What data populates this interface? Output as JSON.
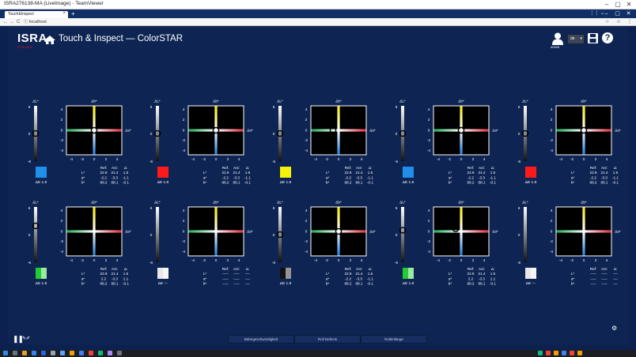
{
  "window": {
    "title": "ISRA276138-MA (LiveImage) - TeamViewer",
    "minimize": "–",
    "maximize": "▢",
    "close": "✕"
  },
  "browser": {
    "tab_label": "Touch&Inspect",
    "tab_close": "×",
    "new_tab": "+",
    "tab_controls": "⋮⋮ ⌄",
    "win_min": "–",
    "win_max": "▢",
    "win_close": "✕",
    "back": "←",
    "forward": "→",
    "reload": "C",
    "url": "ⓘ localhost",
    "bookmark": "☆",
    "account": "☺",
    "menu": "⋮"
  },
  "app": {
    "logo": "ISRA",
    "logo_sub": "VISION",
    "title": "Touch & Inspect — ColorSTAR",
    "user_label": "ADMIN",
    "language": "de",
    "language_caret": "▾",
    "help": "?",
    "accent": "#0e2554"
  },
  "panels": [
    {
      "swatch": "#1f8fe8",
      "swatch_type": "solid",
      "delta": "ΔE 1.8",
      "marker": {
        "a": 0.0,
        "b": 0.0
      },
      "dl": 0,
      "rows": [
        [
          "Ref:",
          "Act:",
          "Δ:"
        ],
        [
          "L*",
          "22.9",
          "21.4",
          "1.5"
        ],
        [
          "a*",
          "-2.2",
          "-3.3",
          "-1.1"
        ],
        [
          "b*",
          "88.2",
          "88.1",
          "-0.1"
        ]
      ]
    },
    {
      "swatch": "#ff1a1a",
      "swatch_type": "solid",
      "delta": "ΔE 1.8",
      "marker": {
        "a": 0.0,
        "b": 0.0
      },
      "dl": 0,
      "rows": [
        [
          "Ref:",
          "Act:",
          "Δ:"
        ],
        [
          "L*",
          "22.9",
          "21.4",
          "1.5"
        ],
        [
          "a*",
          "-2.2",
          "-3.3",
          "-1.1"
        ],
        [
          "b*",
          "88.2",
          "88.1",
          "-0.1"
        ]
      ]
    },
    {
      "swatch": "#f2f20a",
      "swatch_type": "solid",
      "delta": "ΔE 1.8",
      "marker": {
        "a": -1.0,
        "b": 0.0
      },
      "dl": 0,
      "rows": [
        [
          "Ref:",
          "Act:",
          "Δ:"
        ],
        [
          "L*",
          "22.9",
          "21.4",
          "1.5"
        ],
        [
          "a*",
          "-2.2",
          "-3.3",
          "-1.1"
        ],
        [
          "b*",
          "88.2",
          "88.1",
          "-0.1"
        ]
      ]
    },
    {
      "swatch": "#1f8fe8",
      "swatch_type": "solid",
      "delta": "ΔE 1.8",
      "marker": {
        "a": 0.0,
        "b": 0.0
      },
      "dl": 0,
      "rows": [
        [
          "Ref:",
          "Act:",
          "Δ:"
        ],
        [
          "L*",
          "22.9",
          "21.4",
          "1.5"
        ],
        [
          "a*",
          "-2.2",
          "-3.3",
          "-1.1"
        ],
        [
          "b*",
          "88.2",
          "88.1",
          "-0.1"
        ]
      ]
    },
    {
      "swatch": "#ff1a1a",
      "swatch_type": "solid",
      "delta": "ΔE 1.8",
      "marker": {
        "a": 0.0,
        "b": 0.0
      },
      "dl": 0,
      "rows": [
        [
          "Ref:",
          "Act:",
          "Δ:"
        ],
        [
          "L*",
          "22.9",
          "21.4",
          "1.5"
        ],
        [
          "a*",
          "-2.2",
          "-3.3",
          "-1.1"
        ],
        [
          "b*",
          "88.2",
          "88.1",
          "-0.1"
        ]
      ]
    },
    {
      "swatch": "#22cc33",
      "swatch_type": "split",
      "delta": "ΔE 1.8",
      "marker": {
        "a": -1.0,
        "b": 1.0
      },
      "dl": 2,
      "rows": [
        [
          "Ref:",
          "Act:",
          "Δ:"
        ],
        [
          "L*",
          "22.9",
          "21.4",
          "1.5"
        ],
        [
          "a*",
          "2.2",
          "-3.3",
          "1.1"
        ],
        [
          "b*",
          "88.2",
          "88.1",
          "-0.1"
        ]
      ]
    },
    {
      "swatch": "#e8e8e8",
      "swatch_type": "split",
      "delta": "ΔE ---",
      "marker": null,
      "dl": null,
      "rows": [
        [
          "Ref:",
          "Act:",
          "Δ:"
        ],
        [
          "L*",
          "-----",
          "-----",
          "----"
        ],
        [
          "a*",
          "-----",
          "-----",
          "----"
        ],
        [
          "b*",
          "-----",
          "-----",
          "----"
        ]
      ]
    },
    {
      "swatch": "#111111",
      "swatch_type": "split",
      "delta": "ΔE 1.8",
      "marker": {
        "a": 0.0,
        "b": 0.0
      },
      "dl": 0,
      "rows": [
        [
          "Ref:",
          "Act:",
          "Δ:"
        ],
        [
          "L*",
          "22.9",
          "21.4",
          "1.5"
        ],
        [
          "a*",
          "-2.2",
          "-3.3",
          "-1.1"
        ],
        [
          "b*",
          "88.2",
          "88.1",
          "-0.1"
        ]
      ]
    },
    {
      "swatch": "#22cc33",
      "swatch_type": "split",
      "delta": "ΔE 1.8",
      "marker": {
        "a": -1.0,
        "b": 0.5
      },
      "dl": 1,
      "rows": [
        [
          "Ref:",
          "Act:",
          "Δ:"
        ],
        [
          "L*",
          "22.9",
          "21.4",
          "1.5"
        ],
        [
          "a*",
          "2.2",
          "-3.3",
          "1.1"
        ],
        [
          "b*",
          "88.2",
          "88.1",
          "-0.1"
        ]
      ]
    },
    {
      "swatch": "#e8e8e8",
      "swatch_type": "split",
      "delta": "ΔE ---",
      "marker": null,
      "dl": null,
      "rows": [
        [
          "Ref:",
          "Act:",
          "Δ:"
        ],
        [
          "L*",
          "-----",
          "-----",
          "----"
        ],
        [
          "a*",
          "-----",
          "-----",
          "----"
        ],
        [
          "b*",
          "-----",
          "-----",
          "----"
        ]
      ]
    }
  ],
  "chart_labels": {
    "dl": "ΔL*",
    "db": "Δb*",
    "da": "Δa*",
    "ticks_y": [
      "4",
      "2",
      "0",
      "-2",
      "-4"
    ],
    "ticks_x": [
      "-4",
      "-2",
      "0",
      "2",
      "4"
    ],
    "dl_ticks": [
      "6",
      "0",
      "-6"
    ]
  },
  "bottom": {
    "pause": "❚❚",
    "tools": "✎✐",
    "btn1": "Bahngeschwindigkeit",
    "btn2": "Roll Defects",
    "btn3": "Rollenlänge",
    "gear": "⚙"
  }
}
